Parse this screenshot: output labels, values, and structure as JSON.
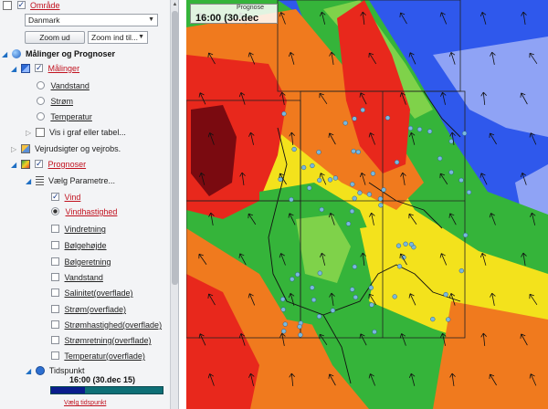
{
  "sidebar": {
    "area": {
      "label": "Område",
      "checked": true
    },
    "region_select": {
      "value": "Danmark"
    },
    "zoom_button": {
      "label": "Zoom ud"
    },
    "zoom_select": {
      "value": "Zoom ind til..."
    },
    "root": {
      "label": "Målinger og Prognoser"
    },
    "measurements": {
      "label": "Målinger",
      "checked": true,
      "items": [
        {
          "label": "Vandstand"
        },
        {
          "label": "Strøm"
        },
        {
          "label": "Temperatur"
        }
      ],
      "graph_link": "Vis i graf eller tabel..."
    },
    "weather": {
      "label": "Vejrudsigter og vejrobs."
    },
    "forecasts": {
      "label": "Prognoser",
      "checked": true,
      "param_group": {
        "label": "Vælg Parametre..."
      },
      "params": [
        {
          "label": "Vind",
          "checked": true,
          "selected": true
        },
        {
          "label": "Vindhastighed",
          "checked": false,
          "selected": true
        },
        {
          "label": "Vindretning",
          "checked": false,
          "selected": false
        },
        {
          "label": "Bølgehøjde",
          "checked": false,
          "selected": false
        },
        {
          "label": "Bølgeretning",
          "checked": false,
          "selected": false
        },
        {
          "label": "Vandstand",
          "checked": false,
          "selected": false
        },
        {
          "label": "Salinitet(overflade)",
          "checked": false,
          "selected": false
        },
        {
          "label": "Strøm(overflade)",
          "checked": false,
          "selected": false
        },
        {
          "label": "Strømhastighed(overflade)",
          "checked": false,
          "selected": false
        },
        {
          "label": "Strømretning(overflade)",
          "checked": false,
          "selected": false
        },
        {
          "label": "Temperatur(overflade)",
          "checked": false,
          "selected": false
        }
      ]
    },
    "timepoint": {
      "label": "Tidspunkt",
      "value": "16:00 (30.dec 15)",
      "progress": 0.3
    },
    "tail_link": "Vælg tidspunkt"
  },
  "map": {
    "badge_label": "Prognose",
    "badge_time": "16:00 (30.dec",
    "colors": {
      "dark_red": "#7a0a10",
      "red": "#e8281c",
      "orange": "#f07a1e",
      "yellow": "#f3e21c",
      "green": "#35b43a",
      "light_green": "#7fd24a",
      "blue": "#2f58ec",
      "light_blue": "#8fa3f5",
      "stations": "#7ab8de"
    }
  }
}
